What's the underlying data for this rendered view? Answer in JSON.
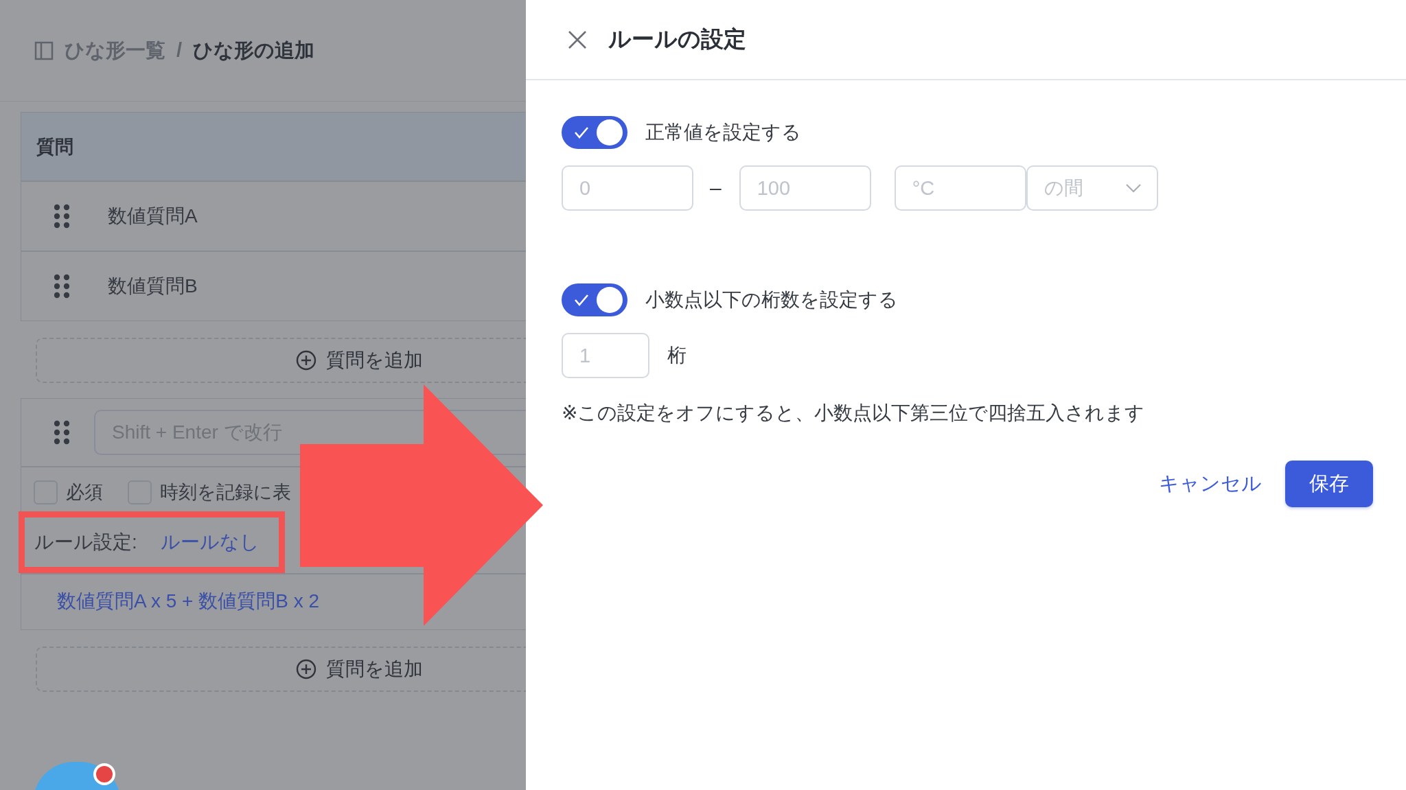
{
  "breadcrumb": {
    "parent": "ひな形一覧",
    "separator": "/",
    "current": "ひな形の追加"
  },
  "questions": {
    "header": "質問",
    "items": [
      {
        "label": "数値質問A"
      },
      {
        "label": "数値質問B"
      }
    ],
    "add_label": "質問を追加"
  },
  "question_editor": {
    "placeholder": "Shift + Enter で改行",
    "options": [
      {
        "label": "必須",
        "checked": false
      },
      {
        "label": "時刻を記録に表",
        "checked": false
      }
    ],
    "rule_label": "ルール設定:",
    "rule_value": "ルールなし",
    "formula": "数値質問A x 5 + 数値質問B x 2",
    "add_label": "質問を追加"
  },
  "dialog": {
    "title": "ルールの設定",
    "normal_range": {
      "label": "正常値を設定する",
      "on": true,
      "min_placeholder": "0",
      "separator": "–",
      "max_placeholder": "100",
      "unit_placeholder": "°C",
      "condition_placeholder": "の間"
    },
    "decimals": {
      "label": "小数点以下の桁数を設定する",
      "on": true,
      "digits_placeholder": "1",
      "unit": "桁"
    },
    "note": "※この設定をオフにすると、小数点以下第三位で四捨五入されます",
    "cancel": "キャンセル",
    "save": "保存"
  }
}
